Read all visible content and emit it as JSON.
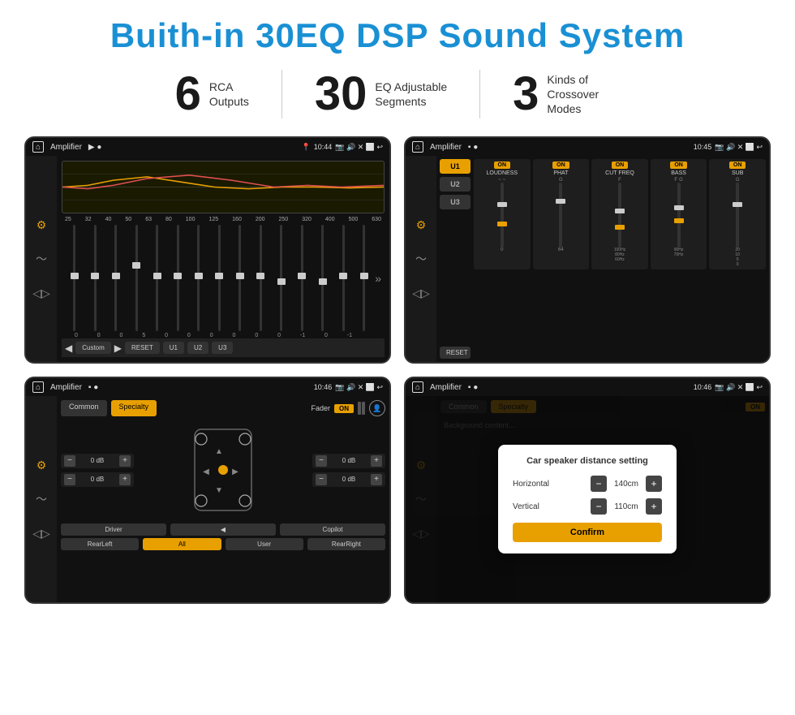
{
  "header": {
    "title": "Buith-in 30EQ DSP Sound System"
  },
  "stats": [
    {
      "number": "6",
      "label": "RCA\nOutputs"
    },
    {
      "number": "30",
      "label": "EQ Adjustable\nSegments"
    },
    {
      "number": "3",
      "label": "Kinds of\nCrossover Modes"
    }
  ],
  "screens": [
    {
      "id": "eq-screen",
      "status": {
        "app": "Amplifier",
        "time": "10:44"
      },
      "type": "eq"
    },
    {
      "id": "crossover-screen",
      "status": {
        "app": "Amplifier",
        "time": "10:45"
      },
      "type": "crossover"
    },
    {
      "id": "fader-screen",
      "status": {
        "app": "Amplifier",
        "time": "10:46"
      },
      "type": "fader"
    },
    {
      "id": "dialog-screen",
      "status": {
        "app": "Amplifier",
        "time": "10:46"
      },
      "type": "dialog",
      "dialog": {
        "title": "Car speaker distance setting",
        "horizontal_label": "Horizontal",
        "horizontal_value": "140cm",
        "vertical_label": "Vertical",
        "vertical_value": "110cm",
        "confirm_label": "Confirm"
      }
    }
  ],
  "eq": {
    "frequencies": [
      "25",
      "32",
      "40",
      "50",
      "63",
      "80",
      "100",
      "125",
      "160",
      "200",
      "250",
      "320",
      "400",
      "500",
      "630"
    ],
    "values": [
      "0",
      "0",
      "0",
      "5",
      "0",
      "0",
      "0",
      "0",
      "0",
      "0",
      "-1",
      "0",
      "-1"
    ],
    "preset": "Custom",
    "buttons": [
      "RESET",
      "U1",
      "U2",
      "U3"
    ]
  },
  "crossover": {
    "units": [
      "U1",
      "U2",
      "U3"
    ],
    "channels": [
      "LOUDNESS",
      "PHAT",
      "CUT FREQ",
      "BASS",
      "SUB"
    ]
  },
  "fader": {
    "tabs": [
      "Common",
      "Specialty"
    ],
    "active_tab": "Specialty",
    "label": "Fader",
    "on": "ON",
    "db_values": [
      "0 dB",
      "0 dB",
      "0 dB",
      "0 dB"
    ],
    "bottom_buttons": [
      "Driver",
      "",
      "Copilot",
      "RearLeft",
      "All",
      "User",
      "RearRight"
    ]
  },
  "dialog": {
    "title": "Car speaker distance setting",
    "horizontal_label": "Horizontal",
    "horizontal_value": "140cm",
    "vertical_label": "Vertical",
    "vertical_value": "110cm",
    "confirm_label": "Confirm"
  }
}
